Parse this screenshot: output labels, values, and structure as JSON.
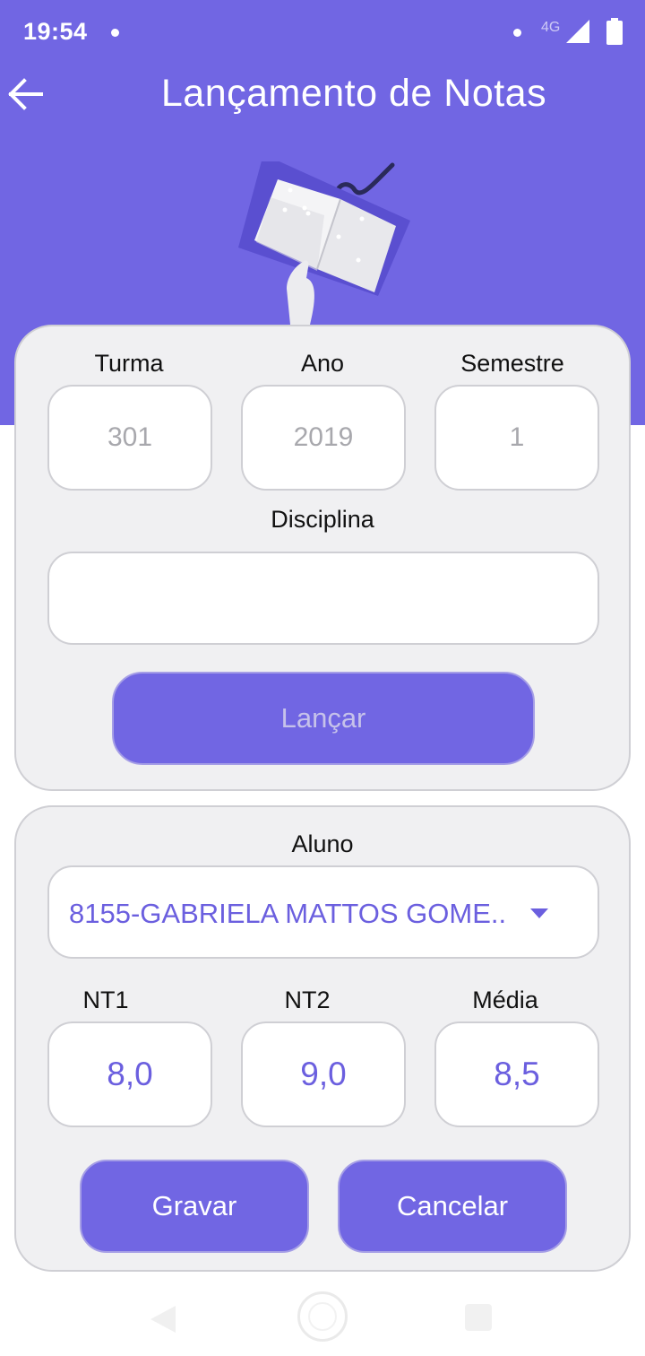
{
  "status_bar": {
    "time": "19:54",
    "network": "4G"
  },
  "header": {
    "title": "Lançamento de Notas"
  },
  "top_card": {
    "turma": {
      "label": "Turma",
      "placeholder": "301"
    },
    "ano": {
      "label": "Ano",
      "placeholder": "2019"
    },
    "semestre": {
      "label": "Semestre",
      "placeholder": "1"
    },
    "disciplina": {
      "label": "Disciplina",
      "value": ""
    },
    "submit_label": "Lançar"
  },
  "bottom_card": {
    "aluno": {
      "label": "Aluno",
      "selected": "8155-GABRIELA MATTOS GOME.."
    },
    "nt1": {
      "label": "NT1",
      "value": "8,0"
    },
    "nt2": {
      "label": "NT2",
      "value": "9,0"
    },
    "media": {
      "label": "Média",
      "value": "8,5"
    },
    "save_label": "Gravar",
    "cancel_label": "Cancelar"
  },
  "icons": {
    "back": "arrow-left-icon",
    "dropdown": "caret-down-icon",
    "signal": "signal-icon",
    "battery": "battery-icon"
  },
  "colors": {
    "accent": "#7166e3",
    "value_text": "#6b5fdf",
    "card_bg": "#f0f0f2"
  }
}
